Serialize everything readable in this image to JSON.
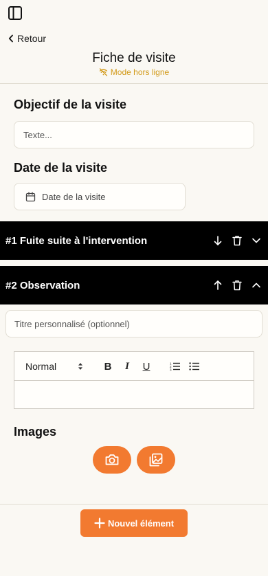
{
  "header": {
    "back_label": "Retour",
    "title": "Fiche de visite",
    "offline_label": "Mode hors ligne"
  },
  "visit": {
    "objective_label": "Objectif de la visite",
    "objective_placeholder": "Texte...",
    "objective_value": "",
    "date_label": "Date de la visite",
    "date_placeholder": "Date de la visite"
  },
  "items": [
    {
      "title": "#1 Fuite suite à l'intervention",
      "expanded": false
    },
    {
      "title": "#2 Observation",
      "expanded": true
    }
  ],
  "observation": {
    "custom_title_placeholder": "Titre personnalisé (optionnel)",
    "custom_title_value": "",
    "editor": {
      "format_value": "Normal",
      "bold_label": "B",
      "italic_label": "I",
      "underline_label": "U",
      "body_text": ""
    },
    "images_label": "Images"
  },
  "footer": {
    "new_item_label": "Nouvel élément"
  },
  "icons": {
    "sidebar": "sidebar-toggle-icon",
    "back": "chevron-left-icon",
    "offline": "wifi-off-icon",
    "calendar": "calendar-icon",
    "move_down": "arrow-down-icon",
    "move_up": "arrow-up-icon",
    "delete": "trash-icon",
    "collapse": "chevron-down-icon",
    "expand": "chevron-up-icon",
    "camera": "camera-icon",
    "gallery": "image-gallery-icon",
    "plus": "plus-icon"
  },
  "colors": {
    "accent": "#f27a30",
    "offline": "#d29a1a",
    "bar_bg": "#000000",
    "page_bg": "#faf8f3"
  }
}
